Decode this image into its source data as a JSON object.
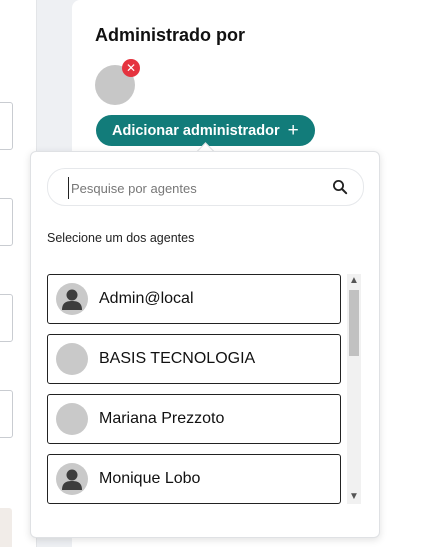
{
  "card": {
    "title": "Administrado por",
    "remove_icon": "close-icon",
    "add_button_label": "Adicionar administrador",
    "add_button_icon": "plus-icon"
  },
  "dropdown": {
    "search_placeholder": "Pesquise por agentes",
    "search_icon": "search-icon",
    "section_label": "Selecione um dos agentes",
    "agents": [
      {
        "name": "Admin@local",
        "avatar": "person-icon"
      },
      {
        "name": "BASIS TECNOLOGIA",
        "avatar": "blank-avatar"
      },
      {
        "name": "Mariana Prezzoto",
        "avatar": "blank-avatar"
      },
      {
        "name": "Monique Lobo",
        "avatar": "person-icon"
      }
    ]
  },
  "colors": {
    "accent": "#127c7a",
    "remove_badge": "#e5333f",
    "avatar_gray": "#c7c7c7"
  }
}
